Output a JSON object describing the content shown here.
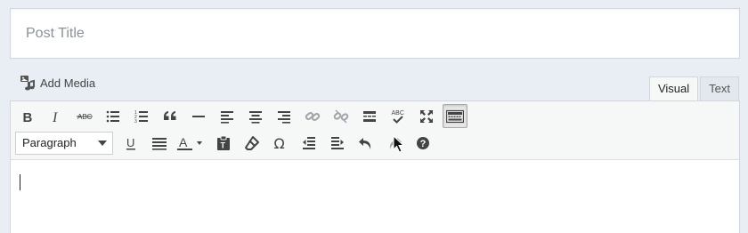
{
  "title_field": {
    "placeholder": "Post Title",
    "value": ""
  },
  "media": {
    "label": "Add Media"
  },
  "tabs": [
    {
      "label": "Visual",
      "active": true
    },
    {
      "label": "Text",
      "active": false
    }
  ],
  "toolbar": {
    "row1": [
      {
        "icon": "bold-icon",
        "glyph": "B"
      },
      {
        "icon": "italic-icon",
        "glyph": "I"
      },
      {
        "icon": "strikethrough-icon",
        "glyph": "ABC"
      },
      {
        "icon": "bulleted-list-icon"
      },
      {
        "icon": "numbered-list-icon"
      },
      {
        "icon": "blockquote-icon"
      },
      {
        "icon": "horizontal-line-icon"
      },
      {
        "icon": "align-left-icon"
      },
      {
        "icon": "align-center-icon"
      },
      {
        "icon": "align-right-icon"
      },
      {
        "icon": "insert-link-icon",
        "disabled": true
      },
      {
        "icon": "remove-link-icon",
        "disabled": true
      },
      {
        "icon": "read-more-icon"
      },
      {
        "icon": "spellcheck-icon",
        "glyph": "ABC"
      },
      {
        "icon": "fullscreen-icon"
      },
      {
        "icon": "toolbar-toggle-icon",
        "active": true
      }
    ],
    "format_select": {
      "value": "Paragraph"
    },
    "row2": [
      {
        "icon": "underline-icon",
        "glyph": "U"
      },
      {
        "icon": "justify-icon"
      },
      {
        "icon": "text-color-icon",
        "glyph": "A"
      },
      {
        "icon": "paste-as-text-icon"
      },
      {
        "icon": "clear-formatting-icon"
      },
      {
        "icon": "special-character-icon",
        "glyph": "Ω"
      },
      {
        "icon": "decrease-indent-icon"
      },
      {
        "icon": "increase-indent-icon"
      },
      {
        "icon": "undo-icon"
      },
      {
        "icon": "redo-icon",
        "disabled": true
      },
      {
        "icon": "help-icon",
        "glyph": "?"
      }
    ]
  },
  "colors": {
    "background": "#e8eef4",
    "icon": "#444444",
    "icon_disabled": "#a0a5aa",
    "border": "#cfd6dd"
  }
}
